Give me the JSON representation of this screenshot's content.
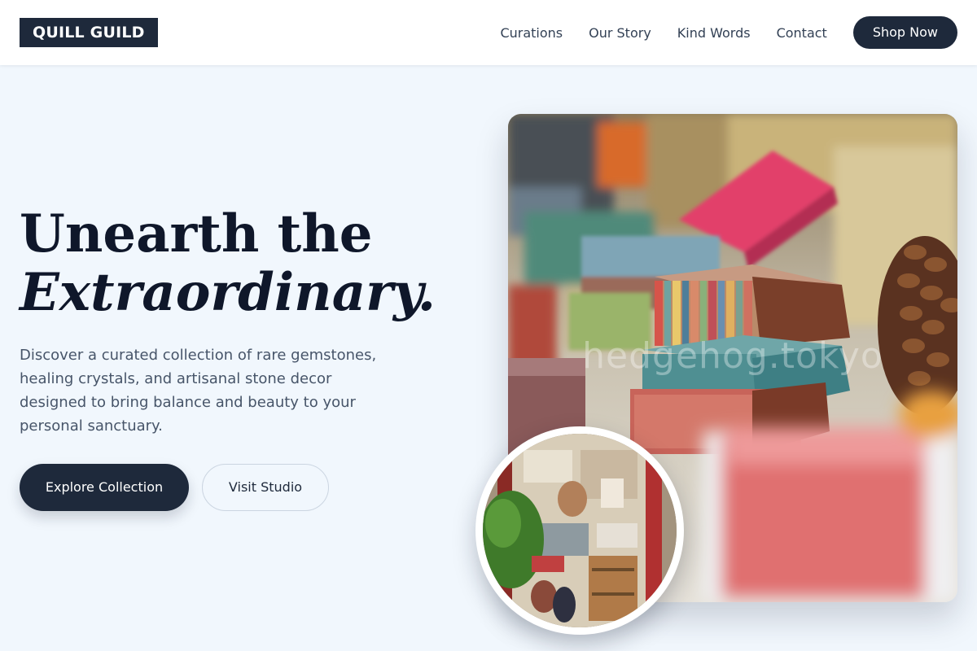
{
  "brand": {
    "logo_text": "QUILL GUILD"
  },
  "nav": {
    "links": [
      "Curations",
      "Our Story",
      "Kind Words",
      "Contact"
    ],
    "cta_label": "Shop Now"
  },
  "hero": {
    "title_line1": "Unearth the",
    "title_line2": "Extraordinary.",
    "description": "Discover a curated collection of rare gemstones, healing crystals, and artisanal stone decor designed to bring balance and beauty to your personal sanctuary.",
    "primary_button": "Explore Collection",
    "secondary_button": "Visit Studio"
  },
  "images": {
    "main_watermark": "hedgehog.tokyo",
    "main_subject": "wrapped artisanal soap bars and pinecone",
    "circle_subject": "shop storefront window"
  },
  "colors": {
    "dark_navy": "#1e293b",
    "page_background": "#f1f7fd",
    "text_muted": "#475569"
  }
}
